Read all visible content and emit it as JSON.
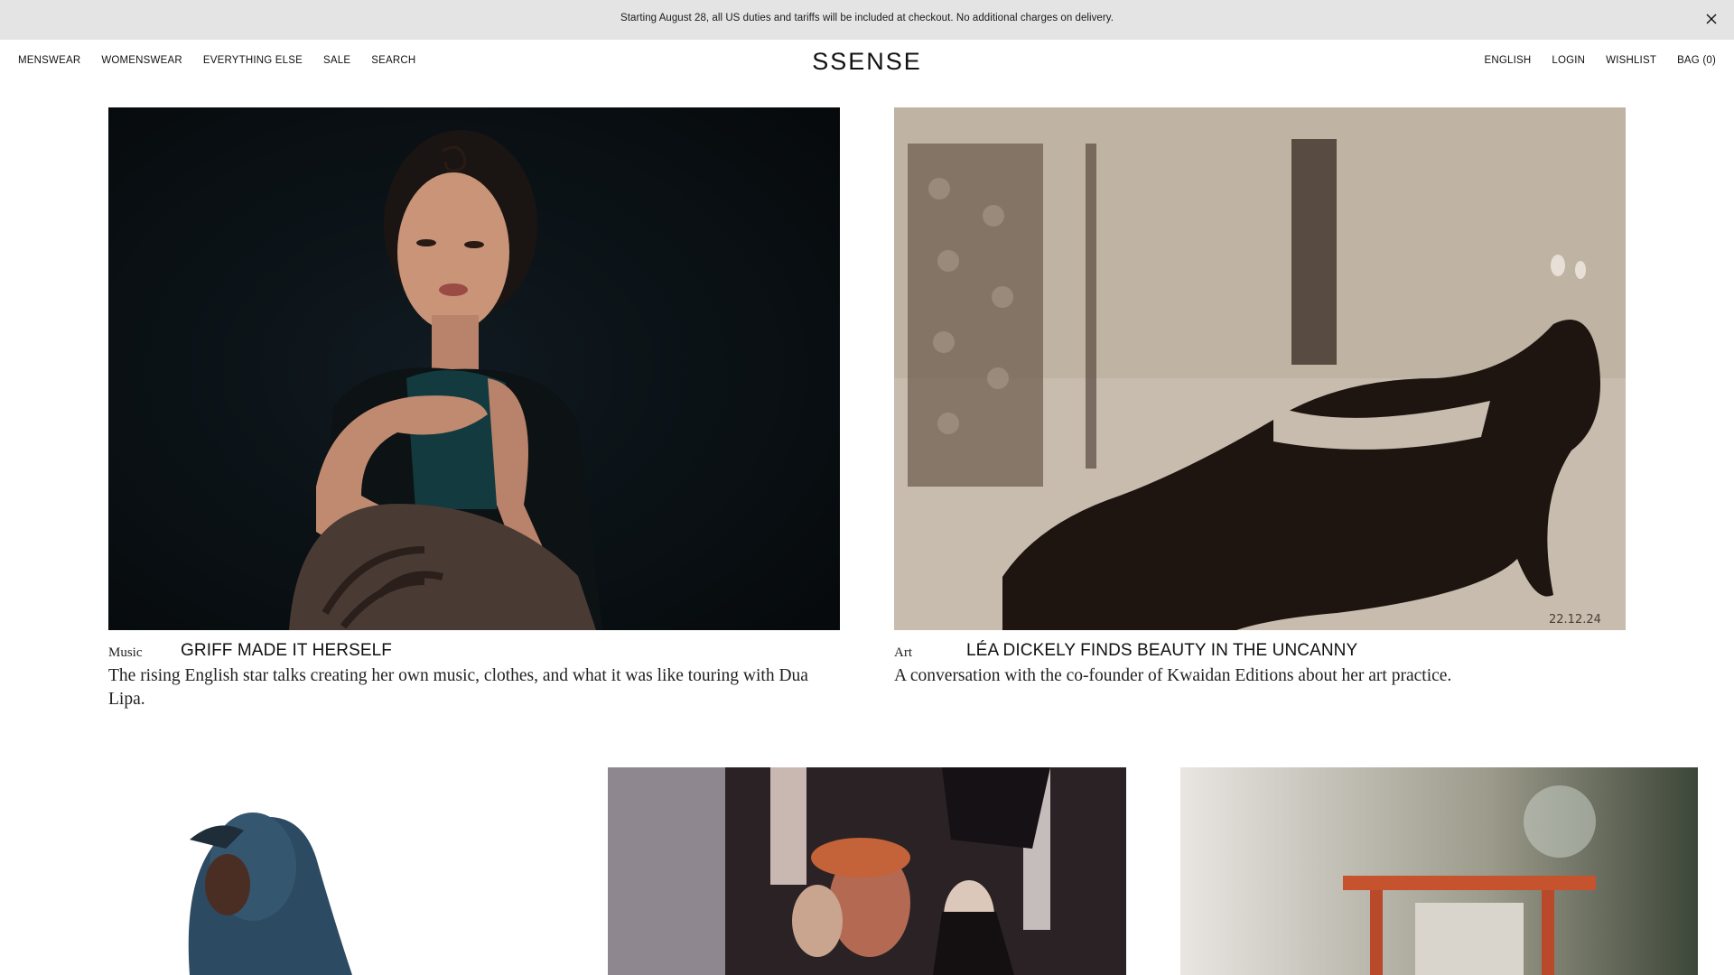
{
  "banner": {
    "text": "Starting August 28, all US duties and tariffs will be included at checkout. No additional charges on delivery.",
    "close_icon": "close-icon"
  },
  "nav": {
    "left": [
      "MENSWEAR",
      "WOMENSWEAR",
      "EVERYTHING ELSE",
      "SALE",
      "SEARCH"
    ],
    "logo": "SSENSE",
    "right": [
      "ENGLISH",
      "LOGIN",
      "WISHLIST",
      "BAG (0)"
    ]
  },
  "features": [
    {
      "category": "Music",
      "headline": "GRIFF MADE IT HERSELF",
      "description": "The rising English star talks creating her own music, clothes, and what it was like touring with Dua Lipa."
    },
    {
      "category": "Art",
      "headline": "LÉA DICKELY FINDS BEAUTY IN THE UNCANNY",
      "description": "A conversation with the co-founder of Kwaidan Editions about her art practice.",
      "image_caption": "22.12.24"
    }
  ],
  "colors": {
    "banner_bg": "#e4e4e4",
    "text": "#111111"
  }
}
